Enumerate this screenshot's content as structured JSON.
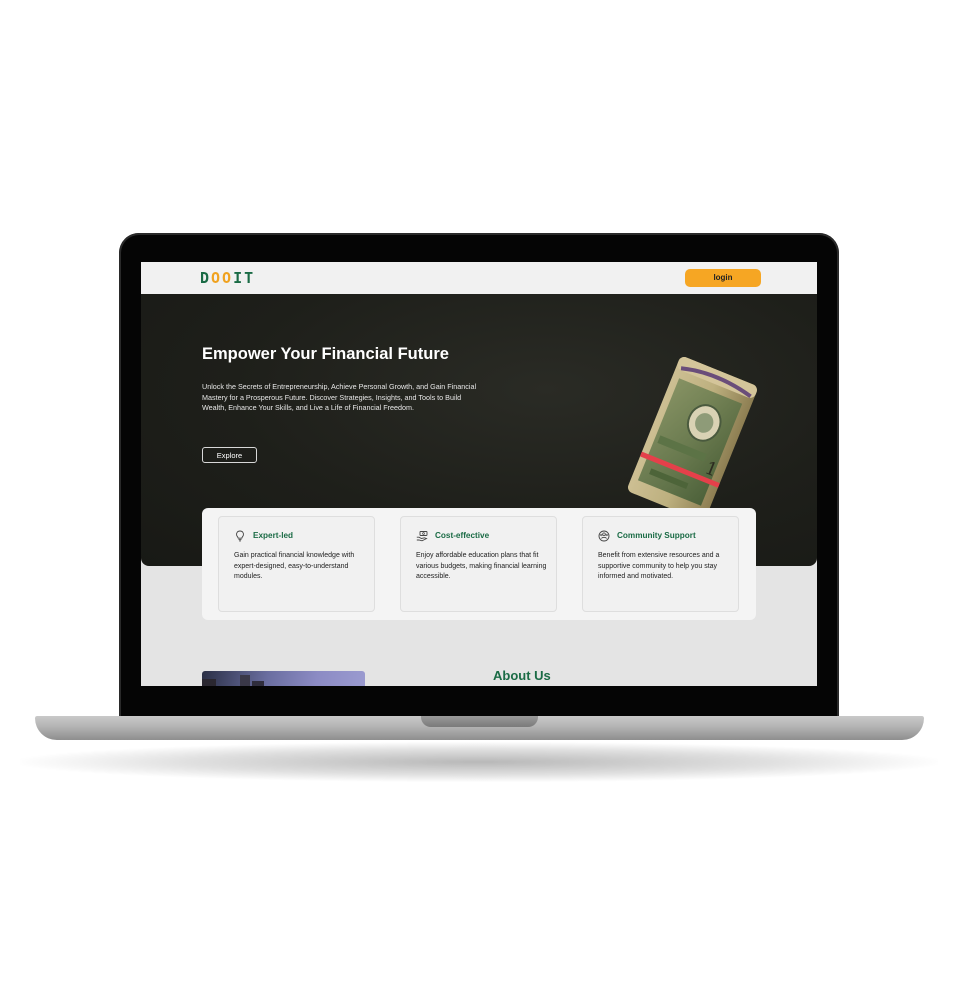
{
  "nav": {
    "logo_main_1": "D",
    "logo_acc_1": "OO",
    "logo_main_2": "I",
    "logo_main_3": "T",
    "login_label": "login"
  },
  "hero": {
    "title": "Empower Your Financial Future",
    "description": "Unlock the Secrets of Entrepreneurship, Achieve Personal Growth, and Gain Financial Mastery for a Prosperous Future. Discover Strategies, Insights, and Tools to Build Wealth, Enhance Your Skills, and Live a Life of Financial Freedom.",
    "explore_label": "Explore"
  },
  "features": [
    {
      "icon": "lightbulb-icon",
      "title": "Expert-led",
      "text": "Gain practical financial knowledge with expert-designed, easy-to-understand modules."
    },
    {
      "icon": "money-hand-icon",
      "title": "Cost-effective",
      "text": "Enjoy affordable education plans that fit various budgets, making financial learning accessible."
    },
    {
      "icon": "community-icon",
      "title": "Community Support",
      "text": "Benefit from extensive resources and a supportive community to help you stay informed and motivated."
    }
  ],
  "about": {
    "title": "About Us"
  },
  "colors": {
    "brand_green": "#1a6b45",
    "accent_orange": "#f6a623",
    "hero_bg": "#1e1f1a"
  }
}
